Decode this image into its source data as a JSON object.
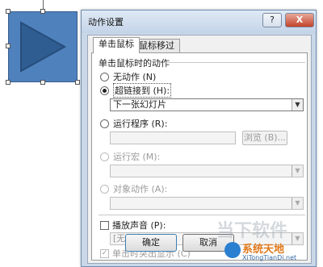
{
  "dialog": {
    "title": "动作设置",
    "help_label": "?",
    "close_label": "X",
    "tabs": [
      {
        "label": "单击鼠标"
      },
      {
        "label": "鼠标移过"
      }
    ],
    "group_title": "单击鼠标时的动作",
    "options": {
      "none": "无动作 (N)",
      "hyperlink": "超链接到 (H):",
      "hyperlink_value": "下一张幻灯片",
      "run_program": "运行程序 (R):",
      "browse": "浏览 (B)...",
      "run_macro": "运行宏 (M):",
      "object_action": "对象动作 (A):"
    },
    "play_sound": "播放声音 (P):",
    "sound_value": "[无声音]",
    "highlight": "单击时突出显示 (C)",
    "highlight_check": "✓",
    "ok": "确定",
    "cancel": "取消"
  },
  "watermark": {
    "faint": "当下软件",
    "brand": "系统天地",
    "url": "XiTongTianDi.net"
  },
  "colors": {
    "shape_fill": "#4f81bd",
    "accent": "#3c7fb1"
  }
}
